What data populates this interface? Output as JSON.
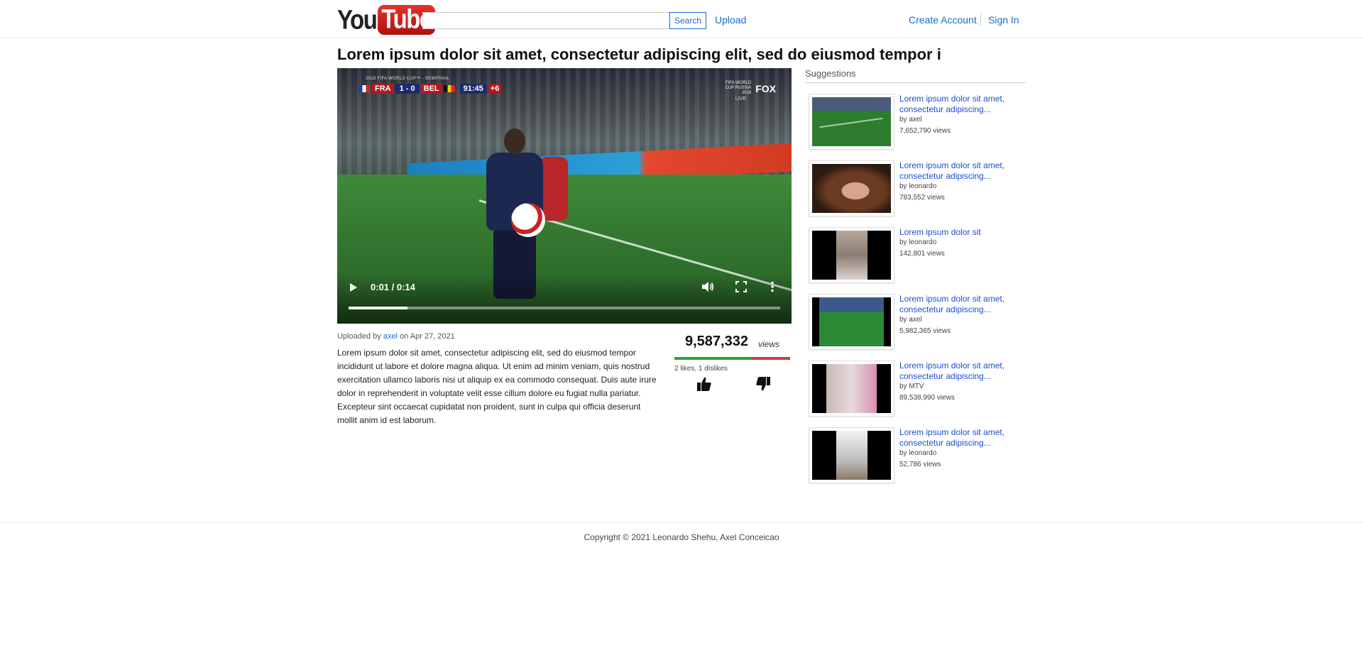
{
  "header": {
    "logo_you": "You",
    "logo_tube": "Tube",
    "search_value": "",
    "search_button": "Search",
    "upload_link": "Upload",
    "create_account_link": "Create Account",
    "sign_in_link": "Sign In"
  },
  "video": {
    "title": "Lorem ipsum dolor sit amet, consectetur adipiscing elit, sed do eiusmod tempor i",
    "time_display": "0:01 / 0:14",
    "progress_fraction": 0.137,
    "overlay": {
      "caption": "2018 FIFA WORLD CUP™ - SEMIFINAL",
      "home": "FRA",
      "score": "1 - 0",
      "away": "BEL",
      "clock": "91:45",
      "added": "+6",
      "broadcast_event": "FIFA WORLD CUP RUSSIA 2018",
      "broadcast_network": "FOX",
      "live": "LIVE"
    }
  },
  "info": {
    "uploaded_prefix": "Uploaded by",
    "uploader": "axel",
    "uploaded_date": "on Apr 27, 2021",
    "description": "Lorem ipsum dolor sit amet, consectetur adipiscing elit, sed do eiusmod tempor incididunt ut labore et dolore magna aliqua. Ut enim ad minim veniam, quis nostrud exercitation ullamco laboris nisi ut aliquip ex ea commodo consequat. Duis aute irure dolor in reprehenderit in voluptate velit esse cillum dolore eu fugiat nulla pariatur. Excepteur sint occaecat cupidatat non proident, sunt in culpa qui officia deserunt mollit anim id est laborum.",
    "views": "9,587,332",
    "views_word": "views",
    "likes_text": "2 likes, 1 dislikes",
    "like_fraction": 0.6667,
    "like_color": "#2ca236",
    "dislike_color": "#d33a3a"
  },
  "suggestions": {
    "header": "Suggestions",
    "items": [
      {
        "title": "Lorem ipsum dolor sit amet, consectetur adipiscing...",
        "author": "by axel",
        "views": "7,652,790 views",
        "thumb": "soccer-thumb"
      },
      {
        "title": "Lorem ipsum dolor sit amet, consectetur adipiscing...",
        "author": "by leonardo",
        "views": "783,552 views",
        "thumb": "girl-thumb"
      },
      {
        "title": "Lorem ipsum dolor sit",
        "author": "by leonardo",
        "views": "142,801 views",
        "thumb": "lab-thumb"
      },
      {
        "title": "Lorem ipsum dolor sit amet, consectetur adipiscing...",
        "author": "by axel",
        "views": "5,982,365 views",
        "thumb": "pitch-thumb"
      },
      {
        "title": "Lorem ipsum dolor sit amet, consectetur adipiscing...",
        "author": "by MTV",
        "views": "89,538,990 views",
        "thumb": "music-thumb"
      },
      {
        "title": "Lorem ipsum dolor sit amet, consectetur adipiscing...",
        "author": "by leonardo",
        "views": "52,786 views",
        "thumb": "room-thumb"
      }
    ]
  },
  "footer": {
    "copyright": "Copyright © 2021 Leonardo Shehu, Axel Conceicao"
  }
}
